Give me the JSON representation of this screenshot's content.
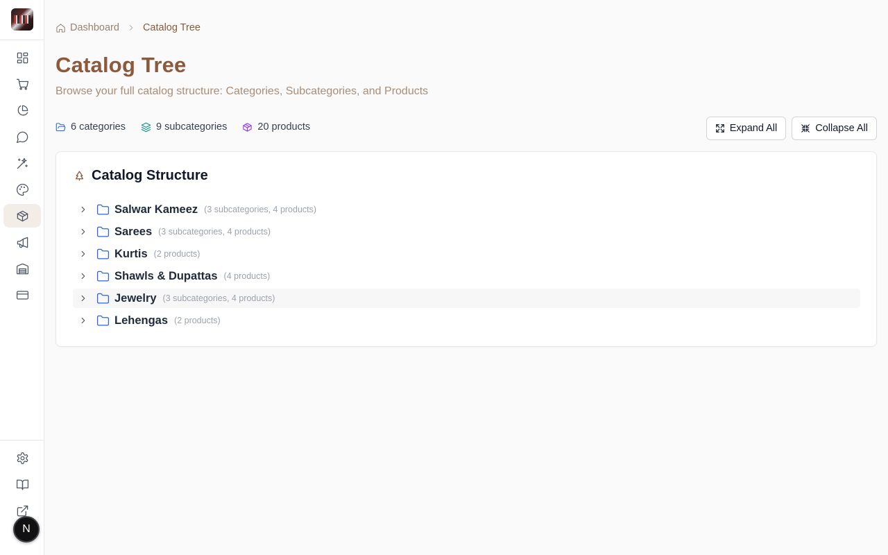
{
  "breadcrumb": {
    "home_label": "Dashboard",
    "current_label": "Catalog Tree"
  },
  "page": {
    "title": "Catalog Tree",
    "subtitle": "Browse your full catalog structure: Categories, Subcategories, and Products"
  },
  "stats": {
    "categories": "6 categories",
    "subcategories": "9 subcategories",
    "products": "20 products"
  },
  "actions": {
    "expand_all": "Expand All",
    "collapse_all": "Collapse All"
  },
  "card": {
    "title": "Catalog Structure"
  },
  "categories": [
    {
      "name": "Salwar Kameez",
      "meta": "(3 subcategories, 4 products)"
    },
    {
      "name": "Sarees",
      "meta": "(3 subcategories, 4 products)"
    },
    {
      "name": "Kurtis",
      "meta": "(2 products)"
    },
    {
      "name": "Shawls & Dupattas",
      "meta": "(4 products)"
    },
    {
      "name": "Jewelry",
      "meta": "(3 subcategories, 4 products)"
    },
    {
      "name": "Lehengas",
      "meta": "(2 products)"
    }
  ],
  "user": {
    "initial": "N"
  },
  "colors": {
    "accent_brown": "#8b5a3c",
    "folder_blue": "#2563eb",
    "subcategory_teal": "#0d9488",
    "product_purple": "#9333ea",
    "active_nav_bg": "#f3ede8"
  },
  "icons": {
    "nav": [
      "dashboard-icon",
      "cart-icon",
      "pie-chart-icon",
      "chat-icon",
      "magic-wand-icon",
      "palette-icon",
      "package-icon",
      "megaphone-icon",
      "warehouse-icon",
      "credit-card-icon"
    ],
    "footer": [
      "settings-icon",
      "book-icon",
      "external-link-icon"
    ]
  }
}
